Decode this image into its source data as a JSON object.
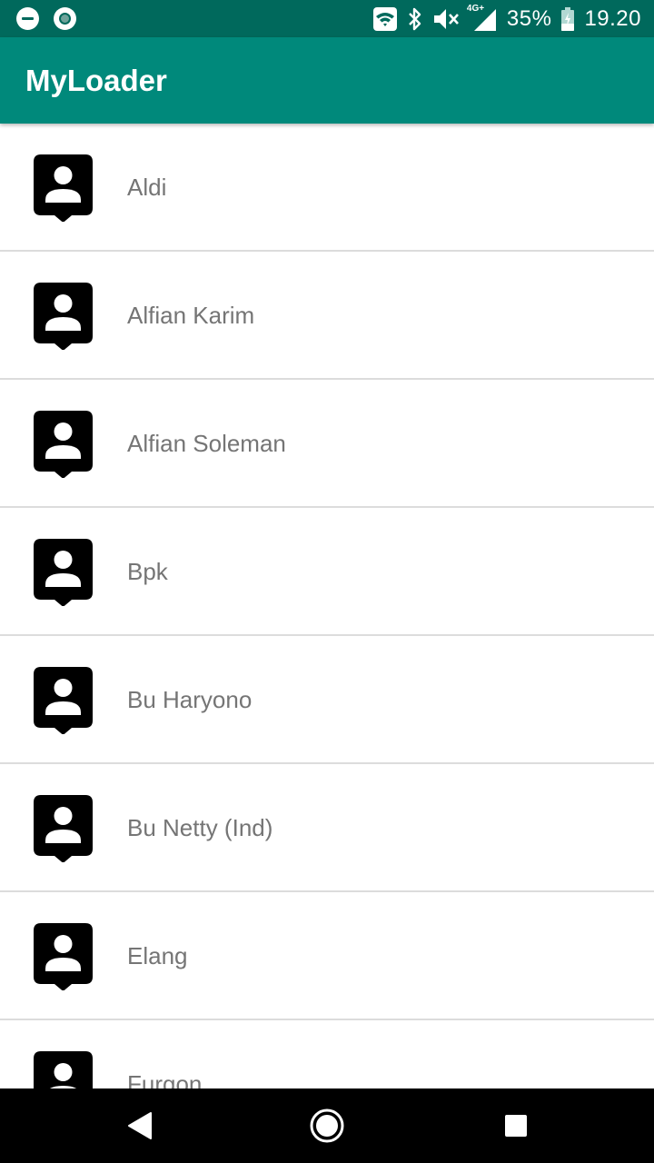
{
  "status_bar": {
    "battery_percent": "35%",
    "time": "19.20",
    "network_label": "4G+",
    "icons": [
      "do-not-disturb-icon",
      "sync-icon",
      "wifi-icon",
      "bluetooth-icon",
      "volume-mute-icon",
      "signal-icon",
      "battery-icon"
    ]
  },
  "app_bar": {
    "title": "MyLoader",
    "color": "#00897b"
  },
  "contacts": [
    {
      "name": "Aldi"
    },
    {
      "name": "Alfian Karim"
    },
    {
      "name": "Alfian Soleman"
    },
    {
      "name": "Bpk"
    },
    {
      "name": "Bu Haryono"
    },
    {
      "name": "Bu Netty (Ind)"
    },
    {
      "name": "Elang"
    },
    {
      "name": "Furgon"
    }
  ],
  "nav_bar": {
    "icons": [
      "back-icon",
      "home-icon",
      "recents-icon"
    ]
  },
  "colors": {
    "status_bar": "#00695c",
    "primary": "#00897b",
    "list_text": "#757575",
    "divider": "#dcdcdc"
  }
}
